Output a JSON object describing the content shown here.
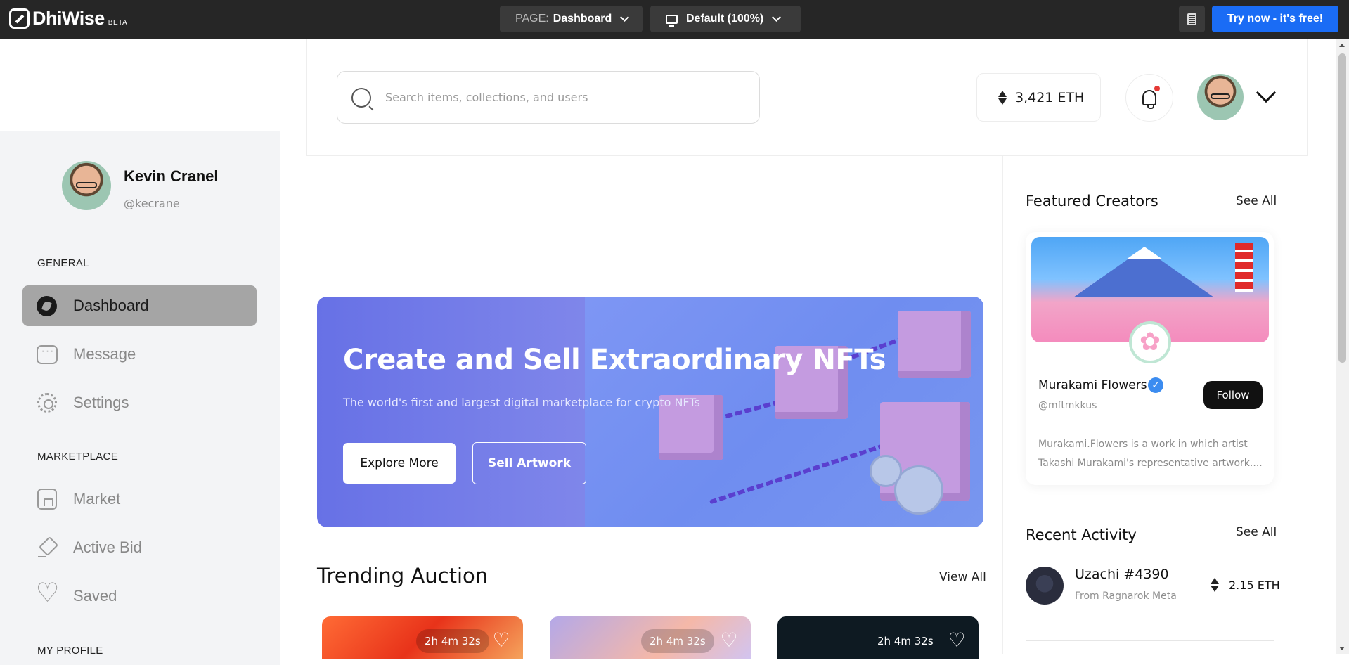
{
  "builder": {
    "logo_text": "DhiWise",
    "logo_badge": "BETA",
    "page_label": "PAGE:",
    "page_value": "Dashboard",
    "view_value": "Default (100%)",
    "try_button": "Try now - it's free!"
  },
  "header": {
    "search_placeholder": "Search items, collections, and users",
    "eth_balance": "3,421 ETH"
  },
  "sidebar": {
    "user_name": "Kevin Cranel",
    "user_handle": "@kecrane",
    "sections": {
      "general": "GENERAL",
      "marketplace": "MARKETPLACE",
      "my_profile": "MY PROFILE"
    },
    "items": [
      {
        "label": "Dashboard",
        "icon": "dashboard-icon",
        "active": true
      },
      {
        "label": "Message",
        "icon": "message-icon",
        "active": false
      },
      {
        "label": "Settings",
        "icon": "settings-icon",
        "active": false
      },
      {
        "label": "Market",
        "icon": "market-icon",
        "active": false
      },
      {
        "label": "Active Bid",
        "icon": "active-bid-icon",
        "active": false
      },
      {
        "label": "Saved",
        "icon": "heart-icon",
        "active": false
      }
    ]
  },
  "hero": {
    "title": "Create and Sell Extraordinary NFTs",
    "subtitle": "The world's first and largest digital marketplace for crypto NFTs",
    "explore_button": "Explore More",
    "sell_button": "Sell Artwork"
  },
  "trending": {
    "title": "Trending Auction",
    "view_all": "View All",
    "cards": [
      {
        "timer": "2h 4m 32s"
      },
      {
        "timer": "2h 4m 32s"
      },
      {
        "timer": "2h 4m 32s"
      }
    ]
  },
  "featured": {
    "title": "Featured Creators",
    "see_all": "See All",
    "creator": {
      "name": "Murakami Flowers",
      "handle": "@mftmkkus",
      "follow": "Follow",
      "description_line1": "Murakami.Flowers is a work in which artist",
      "description_line2": "Takashi Murakami's representative artwork...."
    }
  },
  "activity": {
    "title": "Recent Activity",
    "see_all": "See All",
    "item": {
      "name": "Uzachi #4390",
      "from": "From Ragnarok Meta",
      "price": "2.15 ETH"
    }
  },
  "colors": {
    "topbar": "#262626",
    "accent_blue": "#1a6cf5",
    "hero_left": "#6771e6",
    "hero_right": "#7e96f4",
    "active_nav": "#a5a5a5",
    "notification_dot": "#e53935",
    "verified": "#3b8cf0"
  }
}
